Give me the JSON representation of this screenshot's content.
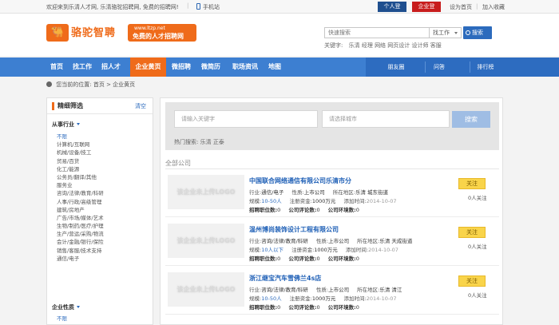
{
  "topbar": {
    "welcome": "欢迎来到乐清人才网, 乐清骆驼招聘网, 免费的招聘网!",
    "mobile": "手机站",
    "person_login": "个人登录",
    "company_login": "企业登录",
    "set_home": "设为首页",
    "add_fav": "加入收藏"
  },
  "header": {
    "logo_icon": "camel-icon",
    "logo_cn": "骆驼智聘",
    "logo_url": "www.ltzp.net",
    "logo_slogan": "免费的人才招聘网",
    "search_placeholder": "快速搜索",
    "search_type": "找工作",
    "search_button": "搜索",
    "keywords_label": "关键字:",
    "keywords": [
      "乐清",
      "经理",
      "网络",
      "网页设计",
      "设计师",
      "客服"
    ]
  },
  "nav": {
    "items": [
      "首页",
      "找工作",
      "招人才",
      "企业黄页",
      "微招聘",
      "微简历",
      "职场资讯",
      "地图"
    ],
    "active_index": 3,
    "right_items": [
      "朋友圈",
      "问答",
      "排行榜"
    ]
  },
  "breadcrumb": {
    "prefix": "您当前的位置:",
    "home": "首页",
    "sep": ">",
    "current": "企业黄页"
  },
  "sidebar": {
    "title": "精细筛选",
    "clear": "清空",
    "industry_label": "从事行业",
    "industries": [
      "不限",
      "计算机/互联网",
      "机械/设备/技工",
      "贸易/百货",
      "化工/能源",
      "公务员/翻译/其他",
      "服务业",
      "咨询/法律/教育/科研",
      "人事/行政/高级管理",
      "建筑/房地产",
      "广告/市场/媒体/艺术",
      "生物/制药/医疗/护理",
      "生产/营运/采购/物流",
      "会计/金融/银行/保险",
      "销售/客服/技术支持",
      "通信/电子"
    ],
    "nature_label": "企业性质",
    "natures": [
      "不限"
    ]
  },
  "filter": {
    "keyword_placeholder": "请输入关键字",
    "city_placeholder": "请选择城市",
    "search_button": "搜索",
    "hot_label": "热门搜索:",
    "hot_items": [
      "乐清",
      "正泰"
    ]
  },
  "companies_label": "全部公司",
  "logo_placeholder": "该企业未上传LOGO",
  "companies": [
    {
      "name": "中国联合网络通信有限公司乐清市分",
      "industry_label": "行业:",
      "industry": "通信/电子",
      "nature_label": "性质:",
      "nature": "上市公司",
      "area_label": "所在地区:",
      "area": "乐清 城东街道",
      "scale_label": "规模:",
      "scale": "10-50人",
      "capital_label": "注册资金:",
      "capital": "1000万元",
      "date_label": "添加时间:",
      "date": "2014-10-07",
      "jobs_label": "招聘职位数:",
      "jobs": "0",
      "reviews_label": "公司评论数:",
      "reviews": "0",
      "rating_label": "公司环境数:",
      "rating": "0",
      "follow": "关注",
      "fans": "0人关注"
    },
    {
      "name": "温州博尚装饰设计工程有限公司",
      "industry_label": "行业:",
      "industry": "咨询/法律/教育/科研",
      "nature_label": "性质:",
      "nature": "上市公司",
      "area_label": "所在地区:",
      "area": "乐清 天成街道",
      "scale_label": "规模:",
      "scale": "10人以下",
      "capital_label": "注册资金:",
      "capital": "1000万元",
      "date_label": "添加时间:",
      "date": "2014-10-07",
      "jobs_label": "招聘职位数:",
      "jobs": "0",
      "reviews_label": "公司评论数:",
      "reviews": "0",
      "rating_label": "公司环境数:",
      "rating": "0",
      "follow": "关注",
      "fans": "0人关注"
    },
    {
      "name": "浙江继宝汽车雪佛兰4s店",
      "industry_label": "行业:",
      "industry": "咨询/法律/教育/科研",
      "nature_label": "性质:",
      "nature": "上市公司",
      "area_label": "所在地区:",
      "area": "乐清 清江",
      "scale_label": "规模:",
      "scale": "10-50人",
      "capital_label": "注册资金:",
      "capital": "1000万元",
      "date_label": "添加时间:",
      "date": "2014-10-07",
      "jobs_label": "招聘职位数:",
      "jobs": "0",
      "reviews_label": "公司评论数:",
      "reviews": "0",
      "rating_label": "公司环境数:",
      "rating": "0",
      "follow": "关注",
      "fans": "0人关注"
    }
  ]
}
